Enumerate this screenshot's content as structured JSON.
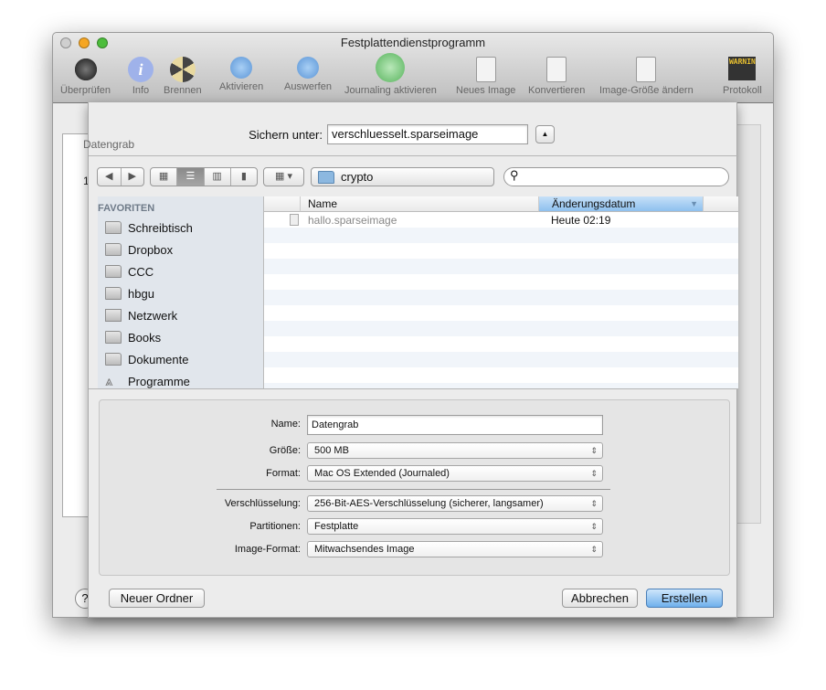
{
  "window": {
    "title": "Festplattendienstprogramm"
  },
  "toolbar": [
    {
      "label": "Überprüfen",
      "icon": "microscope-icon"
    },
    {
      "label": "Info",
      "icon": "info-icon"
    },
    {
      "label": "Brennen",
      "icon": "burn-icon"
    },
    {
      "label": "Aktivieren",
      "icon": "mount-icon"
    },
    {
      "label": "Auswerfen",
      "icon": "eject-icon"
    },
    {
      "label": "Journaling aktivieren",
      "icon": "journaling-icon"
    },
    {
      "label": "Neues Image",
      "icon": "new-image-icon"
    },
    {
      "label": "Konvertieren",
      "icon": "convert-icon"
    },
    {
      "label": "Image-Größe ändern",
      "icon": "resize-image-icon"
    },
    {
      "label": "Protokoll",
      "icon": "log-icon"
    }
  ],
  "log_icon_text": "WARNIN",
  "background": {
    "items": [
      "Datengrab",
      "Datengrab",
      "1"
    ],
    "help": "?"
  },
  "sheet": {
    "save_as_label": "Sichern unter:",
    "save_as_value": "verschluesselt.sparseimage",
    "location": "crypto",
    "search_placeholder": "",
    "sidebar": {
      "heading": "FAVORITEN",
      "items": [
        "Schreibtisch",
        "Dropbox",
        "CCC",
        "hbgu",
        "Netzwerk",
        "Books",
        "Dokumente",
        "Programme"
      ]
    },
    "columns": {
      "name": "Name",
      "date": "Änderungsdatum"
    },
    "files": [
      {
        "name": "hallo.sparseimage",
        "date": "Heute 02:19"
      }
    ],
    "form": {
      "name_label": "Name:",
      "name_value": "Datengrab",
      "size_label": "Größe:",
      "size_value": "500 MB",
      "format_label": "Format:",
      "format_value": "Mac OS Extended (Journaled)",
      "encryption_label": "Verschlüsselung:",
      "encryption_value": "256-Bit-AES-Verschlüsselung (sicherer, langsamer)",
      "partitions_label": "Partitionen:",
      "partitions_value": "Festplatte",
      "image_format_label": "Image-Format:",
      "image_format_value": "Mitwachsendes Image"
    },
    "buttons": {
      "new_folder": "Neuer Ordner",
      "cancel": "Abbrechen",
      "create": "Erstellen"
    }
  },
  "colors": {
    "accent": "#5fa3e6",
    "sidebar": "#e1e6ec"
  }
}
